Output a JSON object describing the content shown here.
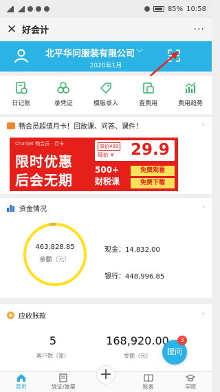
{
  "status": {
    "battery": "85%",
    "time": "10:58"
  },
  "titlebar": {
    "close_icon": "close-icon",
    "title": "好会计",
    "more": "···"
  },
  "header": {
    "company": "北平华问服装有限公司",
    "period": "2020年1月",
    "bg_color": "#2bb3e6"
  },
  "quick_actions": [
    {
      "label": "日记账",
      "icon": "journal-icon"
    },
    {
      "label": "录凭证",
      "icon": "voucher-entry-icon"
    },
    {
      "label": "模版录入",
      "icon": "template-tag-icon"
    },
    {
      "label": "查费用",
      "icon": "expense-icon"
    },
    {
      "label": "费用趋势",
      "icon": "trend-icon"
    }
  ],
  "promo": {
    "headline": "畅会员超值月卡！回放课、问答、课件！",
    "banner": {
      "brand": "Chanjet 畅会员 · 月卡",
      "line1": "限时优惠",
      "line2": "后会无期",
      "original_price": "原价¥99",
      "now_label": "现价 ¥",
      "price": "29.9",
      "courses_line1": "500+",
      "courses_line2": "财税课",
      "tag1": "免费观看",
      "tag2": "免费下载"
    }
  },
  "funds": {
    "title": "资金情况",
    "balance": "463,828.85",
    "balance_label": "余额",
    "unit": "（元）",
    "cash_label": "现金：",
    "cash_value": "14,832.00",
    "bank_label": "银行：",
    "bank_value": "448,996.85",
    "cash_share": 0.032
  },
  "receivables": {
    "title": "应收账款",
    "customers": "5",
    "customers_label": "客户数（家）",
    "amount": "168,920.00",
    "amount_label": "金额（元）"
  },
  "ask": {
    "label": "提问",
    "badge": "3"
  },
  "tabs": [
    {
      "label": "首页",
      "icon": "home-icon"
    },
    {
      "label": "凭证/发票",
      "icon": "voucher-icon"
    },
    {
      "label": "账表",
      "icon": "ledger-icon"
    },
    {
      "label": "学院",
      "icon": "graduation-cap-icon"
    }
  ]
}
